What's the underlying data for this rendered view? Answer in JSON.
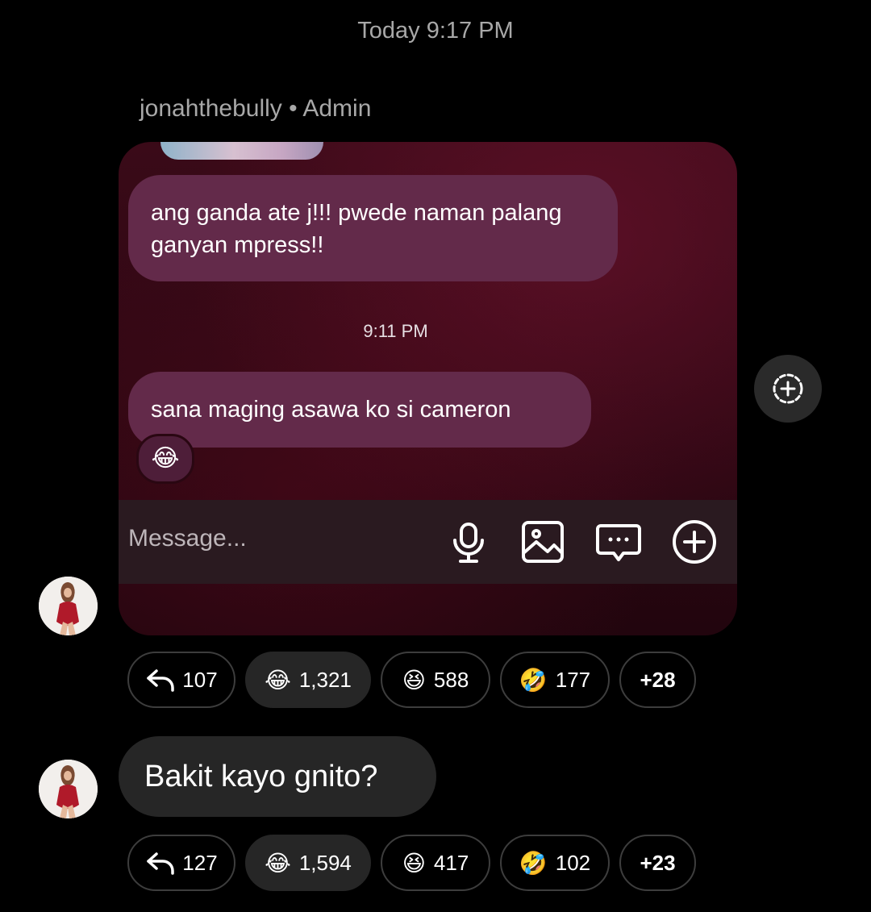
{
  "header": {
    "timestamp": "Today 9:17 PM"
  },
  "message1": {
    "sender": "jonahthebully",
    "role_separator": "•",
    "role": "Admin",
    "screenshot": {
      "bubble1_lines": [
        "ang ganda ate j!!! pwede naman palang",
        "ganyan mpress!!"
      ],
      "inner_time": "9:11 PM",
      "bubble2": "sana maging asawa ko si cameron",
      "inner_reaction_emoji": "😂",
      "composer": {
        "placeholder": "Message...",
        "icons": [
          "microphone-icon",
          "image-icon",
          "sticker-chat-icon",
          "plus-circle-icon"
        ]
      }
    },
    "reactions": [
      {
        "type": "reply",
        "icon": "reply-icon",
        "count": "107"
      },
      {
        "type": "emoji",
        "emoji": "😂",
        "count": "1,321"
      },
      {
        "type": "emoji",
        "emoji": "😆",
        "count": "588"
      },
      {
        "type": "emoji",
        "emoji": "🤣",
        "count": "177"
      },
      {
        "type": "more",
        "count": "+28"
      }
    ]
  },
  "message2": {
    "text": "Bakit kayo gnito?",
    "reactions": [
      {
        "type": "reply",
        "icon": "reply-icon",
        "count": "127"
      },
      {
        "type": "emoji",
        "emoji": "😂",
        "count": "1,594"
      },
      {
        "type": "emoji",
        "emoji": "😆",
        "count": "417"
      },
      {
        "type": "emoji",
        "emoji": "🤣",
        "count": "102"
      },
      {
        "type": "more",
        "count": "+23"
      }
    ]
  },
  "side_button": {
    "icon": "add-to-story-icon"
  },
  "colors": {
    "background": "#000000",
    "muted_text": "#a8a8a8",
    "screenshot_bubble": "#632a4a",
    "plain_bubble": "#262626",
    "chip_filled": "#262626",
    "chip_outline": "#3d3d3d"
  }
}
